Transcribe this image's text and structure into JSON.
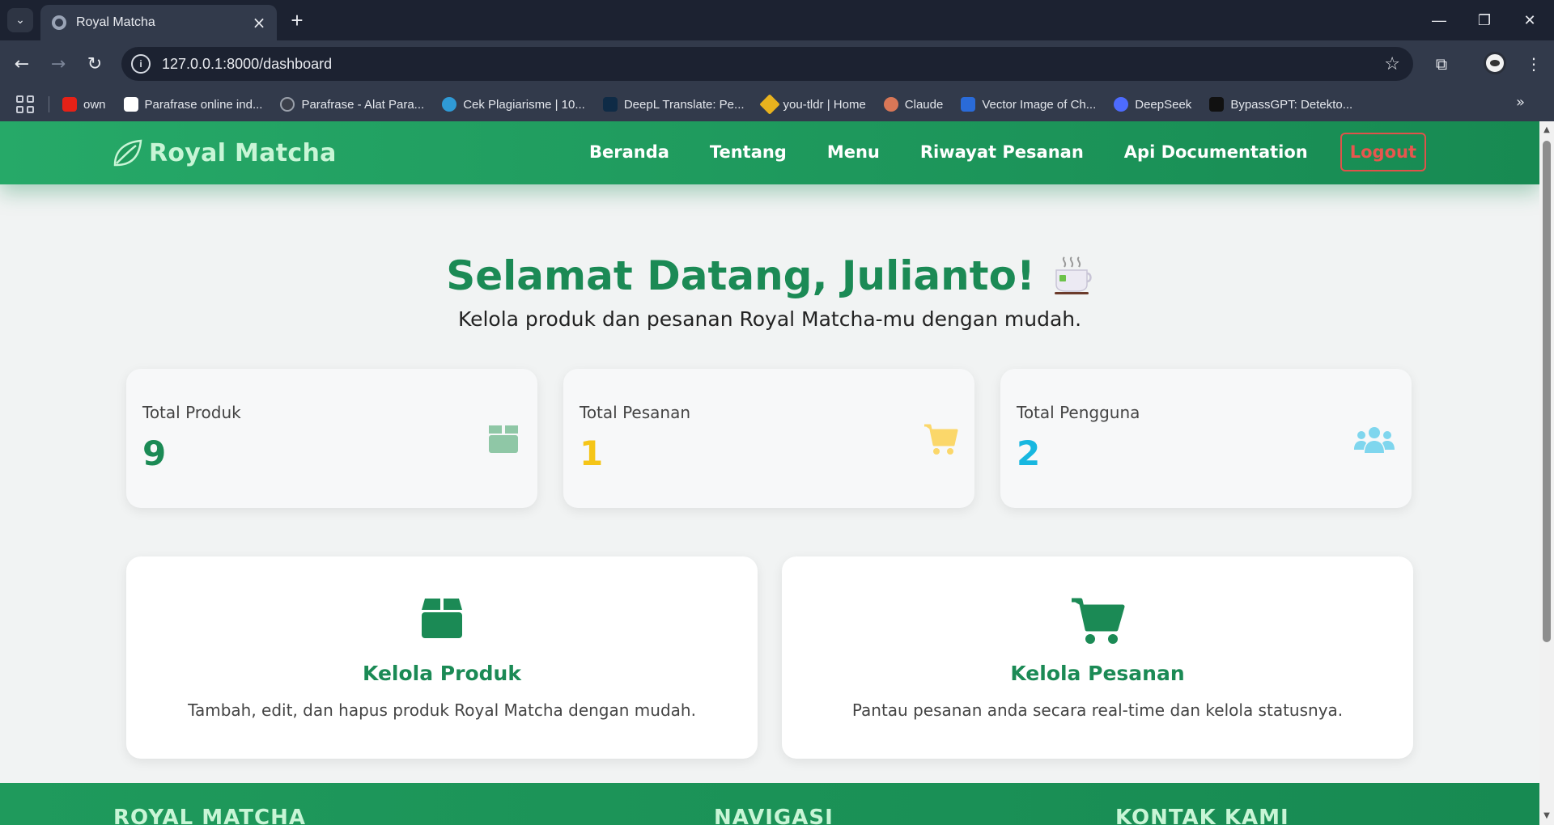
{
  "browser": {
    "tab_title": "Royal Matcha",
    "url": "127.0.0.1:8000/dashboard",
    "bookmarks": [
      {
        "label": "own",
        "color": "#e62117"
      },
      {
        "label": "Parafrase online ind...",
        "color": "#ffffff"
      },
      {
        "label": "Parafrase - Alat Para...",
        "color": "#3b3f4a"
      },
      {
        "label": "Cek Plagiarisme | 10...",
        "color": "#2f9ad6"
      },
      {
        "label": "DeepL Translate: Pe...",
        "color": "#0f2b46"
      },
      {
        "label": "you-tldr | Home",
        "color": "#e8b21e"
      },
      {
        "label": "Claude",
        "color": "#d97757"
      },
      {
        "label": "Vector Image of Ch...",
        "color": "#2a6bd9"
      },
      {
        "label": "DeepSeek",
        "color": "#4d6bfe"
      },
      {
        "label": "BypassGPT: Detekto...",
        "color": "#111111"
      }
    ]
  },
  "navbar": {
    "brand": "Royal Matcha",
    "links": [
      "Beranda",
      "Tentang",
      "Menu",
      "Riwayat Pesanan",
      "Api Documentation"
    ],
    "logout": "Logout"
  },
  "hero": {
    "title": "Selamat Datang, Julianto!",
    "subtitle": "Kelola produk dan pesanan Royal Matcha-mu dengan mudah."
  },
  "stats": [
    {
      "label": "Total Produk",
      "value": "9",
      "color": "#1b8a55",
      "icon": "box-icon"
    },
    {
      "label": "Total Pesanan",
      "value": "1",
      "color": "#f5c518",
      "icon": "cart-icon"
    },
    {
      "label": "Total Pengguna",
      "value": "2",
      "color": "#17b7e0",
      "icon": "users-icon"
    }
  ],
  "actions": [
    {
      "title": "Kelola Produk",
      "desc": "Tambah, edit, dan hapus produk Royal Matcha dengan mudah.",
      "icon": "box-icon"
    },
    {
      "title": "Kelola Pesanan",
      "desc": "Pantau pesanan anda secara real-time dan kelola statusnya.",
      "icon": "cart-icon"
    }
  ],
  "footer": {
    "columns": [
      "ROYAL MATCHA",
      "NAVIGASI",
      "KONTAK KAMI"
    ]
  },
  "colors": {
    "accent": "#1b8a55",
    "nav_green": "#26a968",
    "logout_red": "#e8564e"
  }
}
